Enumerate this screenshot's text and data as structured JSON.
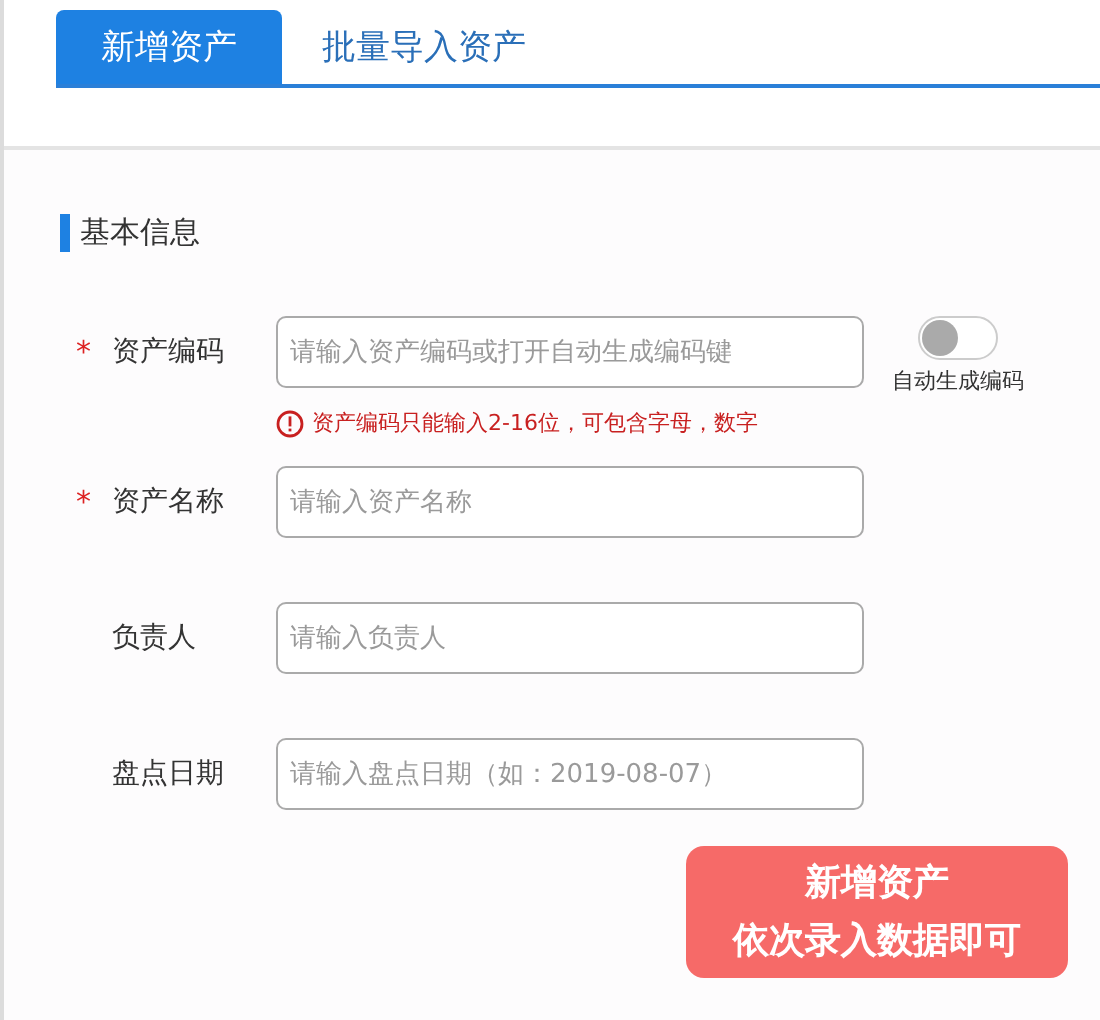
{
  "tabs": [
    {
      "label": "新增资产",
      "selected": true
    },
    {
      "label": "批量导入资产",
      "selected": false
    }
  ],
  "section_title": "基本信息",
  "fields": [
    {
      "label": "资产编码",
      "required_mark": "*",
      "placeholder": "请输入资产编码或打开自动生成编码键",
      "error": "资产编码只能输入2-16位，可包含字母，数字",
      "toggle": {
        "label": "自动生成编码",
        "on": false
      }
    },
    {
      "label": "资产名称",
      "required_mark": "*",
      "placeholder": "请输入资产名称"
    },
    {
      "label": "负责人",
      "placeholder": "请输入负责人"
    },
    {
      "label": "盘点日期",
      "placeholder": "请输入盘点日期（如：2019-08-07）"
    }
  ],
  "callout": {
    "lines": [
      "新增资产",
      "依次录入数据即可"
    ]
  }
}
